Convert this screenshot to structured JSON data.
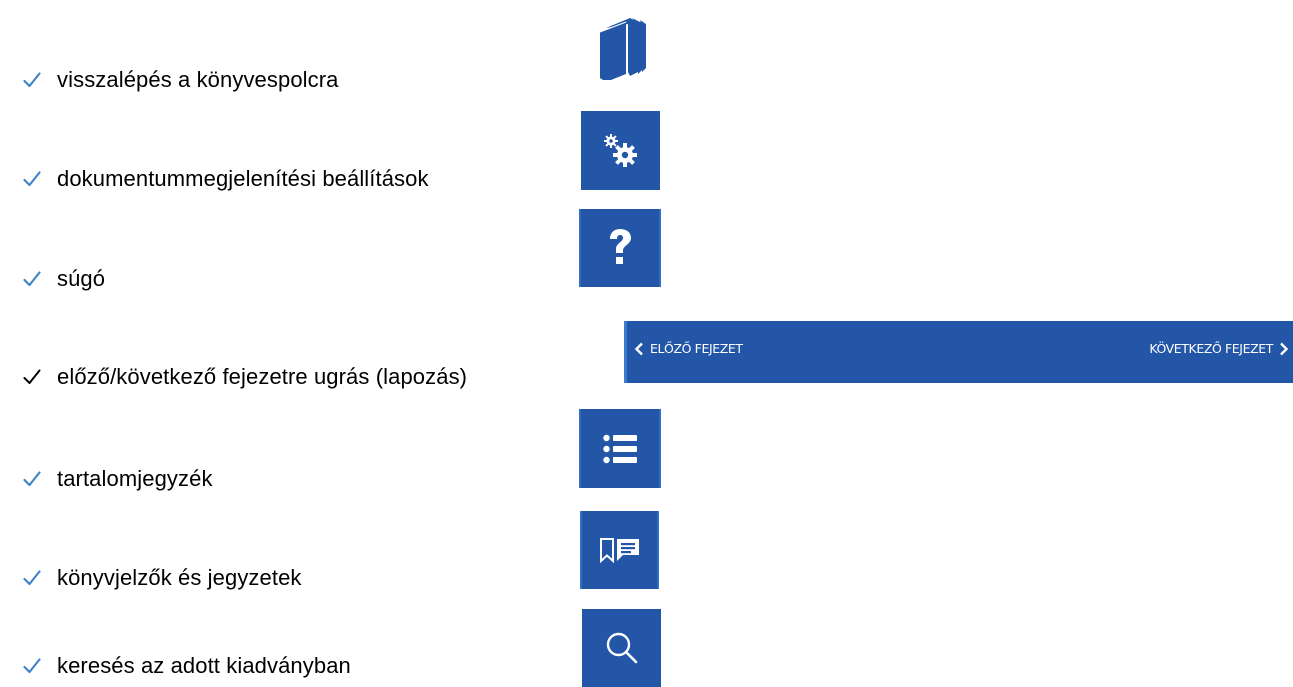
{
  "items": [
    {
      "label": "visszalépés a könyvespolcra",
      "icon": "books-icon"
    },
    {
      "label": "dokumentummegjelenítési beállítások",
      "icon": "gears-icon"
    },
    {
      "label": "súgó",
      "icon": "question-icon"
    },
    {
      "label": "előző/következő fejezetre ugrás (lapozás)",
      "icon": "chapter-nav"
    },
    {
      "label": "tartalomjegyzék",
      "icon": "list-icon"
    },
    {
      "label": "könyvjelzők és jegyzetek",
      "icon": "bookmark-note-icon"
    },
    {
      "label": "keresés az adott kiadványban",
      "icon": "search-icon"
    }
  ],
  "nav": {
    "prev_label": "ELŐZŐ FEJEZET",
    "next_label": "KÖVETKEZŐ FEJEZET"
  },
  "colors": {
    "button_blue": "#2356a6",
    "check_blue": "#3f85c6",
    "check_black": "#000000"
  }
}
